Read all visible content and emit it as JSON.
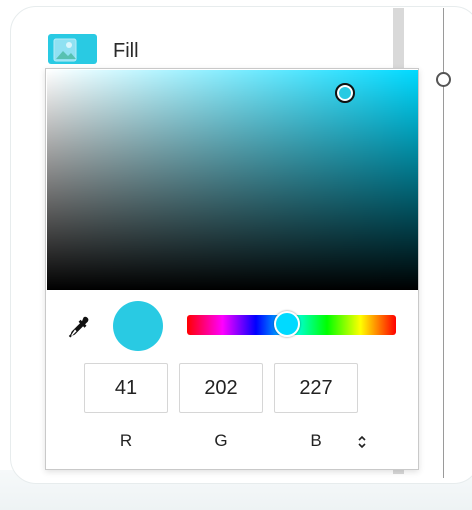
{
  "fill": {
    "label": "Fill",
    "swatch_color": "#29CAE3",
    "icon": "image-placeholder-icon"
  },
  "color_picker": {
    "hue_base_color": "#00DAFF",
    "selected_color": "#29CAE3",
    "hue_position": 0.48,
    "eyedropper_icon": "eyedropper-icon",
    "channels": [
      {
        "label": "R",
        "value": "41"
      },
      {
        "label": "G",
        "value": "202"
      },
      {
        "label": "B",
        "value": "227"
      }
    ],
    "mode_toggle_icon": "chevron-up-down-icon"
  }
}
